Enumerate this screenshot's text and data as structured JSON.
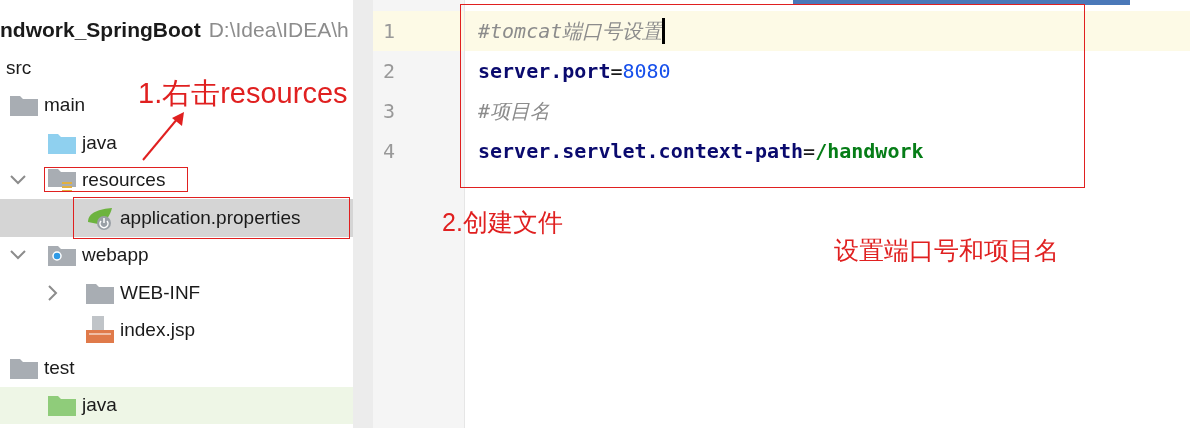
{
  "project": {
    "name": "ndwork_SpringBoot",
    "path": "D:\\Idea\\IDEA\\h"
  },
  "tree": [
    {
      "label": "src",
      "selected": false,
      "children": [
        {
          "label": "main",
          "kind": "folder",
          "selected": false,
          "children": [
            {
              "label": "java",
              "kind": "source-folder",
              "selected": false
            },
            {
              "label": "resources",
              "kind": "resource-folder",
              "expanded": true,
              "selected": false,
              "children": [
                {
                  "label": "application.properties",
                  "kind": "properties-file",
                  "selected": true
                }
              ]
            },
            {
              "label": "webapp",
              "kind": "web-folder",
              "expanded": true,
              "selected": false,
              "children": [
                {
                  "label": "WEB-INF",
                  "kind": "folder",
                  "expanded": false,
                  "selected": false
                },
                {
                  "label": "index.jsp",
                  "kind": "jsp-file",
                  "selected": false
                }
              ]
            }
          ]
        },
        {
          "label": "test",
          "kind": "folder",
          "selected": false,
          "children": [
            {
              "label": "java",
              "kind": "test-folder",
              "selected": false
            }
          ]
        }
      ]
    }
  ],
  "editor": {
    "lines": [
      {
        "number": "1",
        "current": true,
        "tokens": [
          {
            "kind": "comment",
            "text": "#tomcat端口号设置"
          }
        ]
      },
      {
        "number": "2",
        "current": false,
        "tokens": [
          {
            "kind": "key",
            "text": "server.port"
          },
          {
            "kind": "op",
            "text": "="
          },
          {
            "kind": "number",
            "text": "8080"
          }
        ]
      },
      {
        "number": "3",
        "current": false,
        "tokens": [
          {
            "kind": "comment",
            "text": "#项目名"
          }
        ]
      },
      {
        "number": "4",
        "current": false,
        "tokens": [
          {
            "kind": "key",
            "text": "server.servlet.context-path"
          },
          {
            "kind": "op",
            "text": "="
          },
          {
            "kind": "value",
            "text": "/handwork"
          }
        ]
      }
    ]
  },
  "annotations": [
    {
      "text": "1.右击resources"
    },
    {
      "text": "2.创建文件"
    },
    {
      "text": "设置端口号和项目名"
    }
  ]
}
